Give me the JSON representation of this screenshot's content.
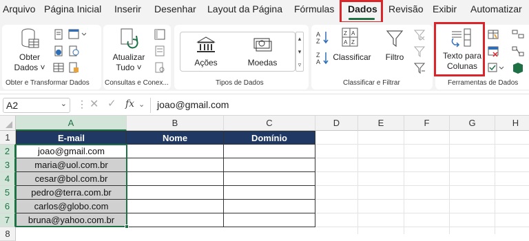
{
  "menu": {
    "tabs": [
      "Arquivo",
      "Página Inicial",
      "Inserir",
      "Desenhar",
      "Layout da Página",
      "Fórmulas",
      "Dados",
      "Revisão",
      "Exibir",
      "Automatizar"
    ],
    "active_tab": "Dados"
  },
  "ribbon": {
    "groups": {
      "obter": "Obter e Transformar Dados",
      "consultas": "Consultas e Conex...",
      "tipos": "Tipos de Dados",
      "classificar": "Classificar e Filtrar",
      "ferramentas": "Ferramentas de Dados"
    },
    "buttons": {
      "obter_line1": "Obter",
      "obter_line2": "Dados ˅",
      "atualizar_line1": "Atualizar",
      "atualizar_line2": "Tudo ˅",
      "acoes": "Ações",
      "moedas": "Moedas",
      "classificar": "Classificar",
      "filtro": "Filtro",
      "texto_line1": "Texto para",
      "texto_line2": "Colunas"
    }
  },
  "formula_bar": {
    "name_box": "A2",
    "fx": "fx",
    "content": "joao@gmail.com"
  },
  "sheet": {
    "columns": [
      "A",
      "B",
      "C",
      "D",
      "E",
      "F",
      "G",
      "H"
    ],
    "rows": [
      "1",
      "2",
      "3",
      "4",
      "5",
      "6",
      "7",
      "8"
    ],
    "headers": [
      "E-mail",
      "Nome",
      "Domínio"
    ],
    "emails": [
      "joao@gmail.com",
      "maria@uol.com.br",
      "cesar@bol.com.br",
      "pedro@terra.com.br",
      "carlos@globo.com",
      "bruna@yahoo.com.br"
    ]
  },
  "colors": {
    "accent": "#1e7145",
    "highlight": "#d9242a",
    "header_fill": "#1f3864"
  }
}
